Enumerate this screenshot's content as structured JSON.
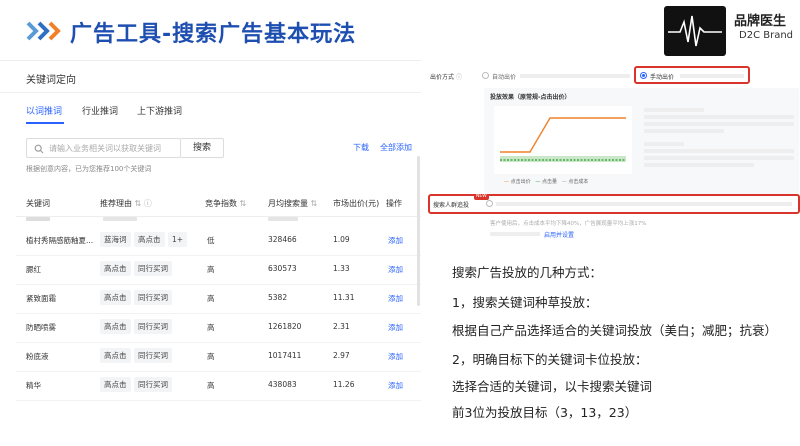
{
  "header": {
    "title": "广告工具-搜索广告基本玩法",
    "brand_name": "品牌医生",
    "brand_sub": "D2C Brand"
  },
  "keyword_panel": {
    "title": "关键词定向",
    "tabs": [
      "以词推词",
      "行业推词",
      "上下游推词"
    ],
    "search_placeholder": "请输入业务相关词以获取关键词",
    "search_button": "搜索",
    "download": "下载",
    "add_all": "全部添加",
    "hint": "根据创意内容，已为您推荐100个关键词",
    "columns": [
      "关键词",
      "推荐理由",
      "竞争指数",
      "月均搜索量",
      "市场出价(元)",
      "操作"
    ],
    "rows": [
      {
        "keyword": "植村秀隔感筋釉夏...",
        "tags": [
          "蓝海词",
          "高点击",
          "1+"
        ],
        "competition": "低",
        "volume": "328466",
        "price": "1.09",
        "action": "添加"
      },
      {
        "keyword": "腮红",
        "tags": [
          "高点击",
          "同行买词"
        ],
        "competition": "高",
        "volume": "630573",
        "price": "1.33",
        "action": "添加"
      },
      {
        "keyword": "紧致面霜",
        "tags": [
          "高点击",
          "同行买词"
        ],
        "competition": "高",
        "volume": "5382",
        "price": "11.31",
        "action": "添加"
      },
      {
        "keyword": "防晒喷雾",
        "tags": [
          "高点击",
          "同行买词"
        ],
        "competition": "高",
        "volume": "1261820",
        "price": "2.31",
        "action": "添加"
      },
      {
        "keyword": "粉底液",
        "tags": [
          "高点击",
          "同行买词"
        ],
        "competition": "高",
        "volume": "1017411",
        "price": "2.97",
        "action": "添加"
      },
      {
        "keyword": "精华",
        "tags": [
          "高点击",
          "同行买词"
        ],
        "competition": "高",
        "volume": "438083",
        "price": "11.26",
        "action": "添加"
      }
    ]
  },
  "bid_panel": {
    "bid_label": "出价方式",
    "auto_bid": "自动出价",
    "manual_bid": "手动出价",
    "effect_title": "投放效果（原常规-点击出价）",
    "legend": [
      "点击出价",
      "点击量",
      "点击成本"
    ],
    "audience_label": "搜索人群追投",
    "new_badge": "NEW",
    "bottom_text": "客户使用后，点击成本平均下降40%，广告展现量平均上涨17%",
    "bottom_link": "启用并设置"
  },
  "notes": [
    "搜索广告投放的几种方式：",
    "1，搜索关键词种草投放：",
    "根据自己产品选择适合的关键词投放（美白；减肥；抗衰）",
    "2，明确目标下的关键词卡位投放：",
    "选择合适的关键词，以卡搜索关键词",
    "前3位为投放目标（3，13，23）"
  ],
  "colors": {
    "title_blue": "#1e4fb0",
    "arrow_light": "#5b9bd5",
    "arrow_orange": "#f0812b",
    "link_blue": "#2962ff",
    "highlight_red": "#d9342b",
    "chart_green": "#2ca02c"
  }
}
